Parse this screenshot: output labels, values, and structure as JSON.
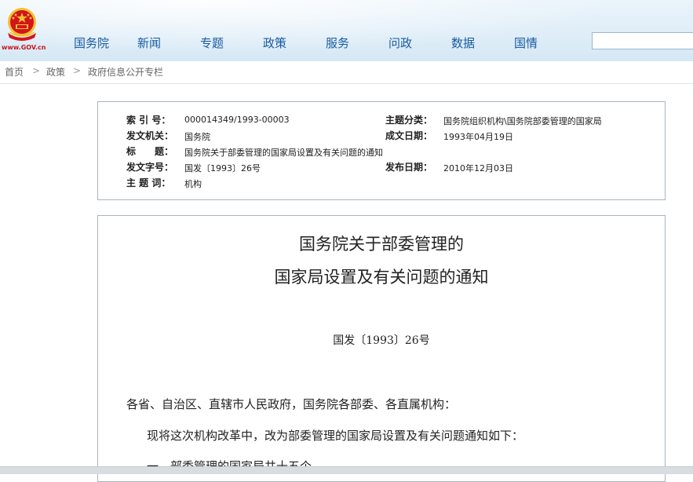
{
  "header": {
    "site_url": "www.GOV.cn",
    "nav": [
      "国务院",
      "新闻",
      "专题",
      "政策",
      "服务",
      "问政",
      "数据",
      "国情"
    ],
    "search": {
      "value": "",
      "placeholder": ""
    }
  },
  "breadcrumb": {
    "items": [
      "首页",
      "政策",
      "政府信息公开专栏"
    ],
    "separator": ">"
  },
  "info": {
    "index_label": "索 引 号：",
    "index_value": "000014349/1993-00003",
    "category_label": "主题分类：",
    "category_value": "国务院组织机构\\国务院部委管理的国家局",
    "issuer_label": "发文机关：",
    "issuer_value": "国务院",
    "written_label": "成文日期：",
    "written_value": "1993年04月19日",
    "title_label": "标　　题：",
    "title_value": "国务院关于部委管理的国家局设置及有关问题的通知",
    "docno_label": "发文字号：",
    "docno_value": "国发〔1993〕26号",
    "published_label": "发布日期：",
    "published_value": "2010年12月03日",
    "keyword_label": "主 题 词：",
    "keyword_value": "机构"
  },
  "document": {
    "title_line1": "国务院关于部委管理的",
    "title_line2": "国家局设置及有关问题的通知",
    "number": "国发〔1993〕26号",
    "salutation": "各省、自治区、直辖市人民政府，国务院各部委、各直属机构：",
    "para1": "现将这次机构改革中，改为部委管理的国家局设置及有关问题通知如下：",
    "para2": "一、部委管理的国家局共十五个"
  },
  "colors": {
    "nav": "#1a5aa0",
    "emblem_red": "#d4141c",
    "emblem_gold": "#f2c230"
  }
}
